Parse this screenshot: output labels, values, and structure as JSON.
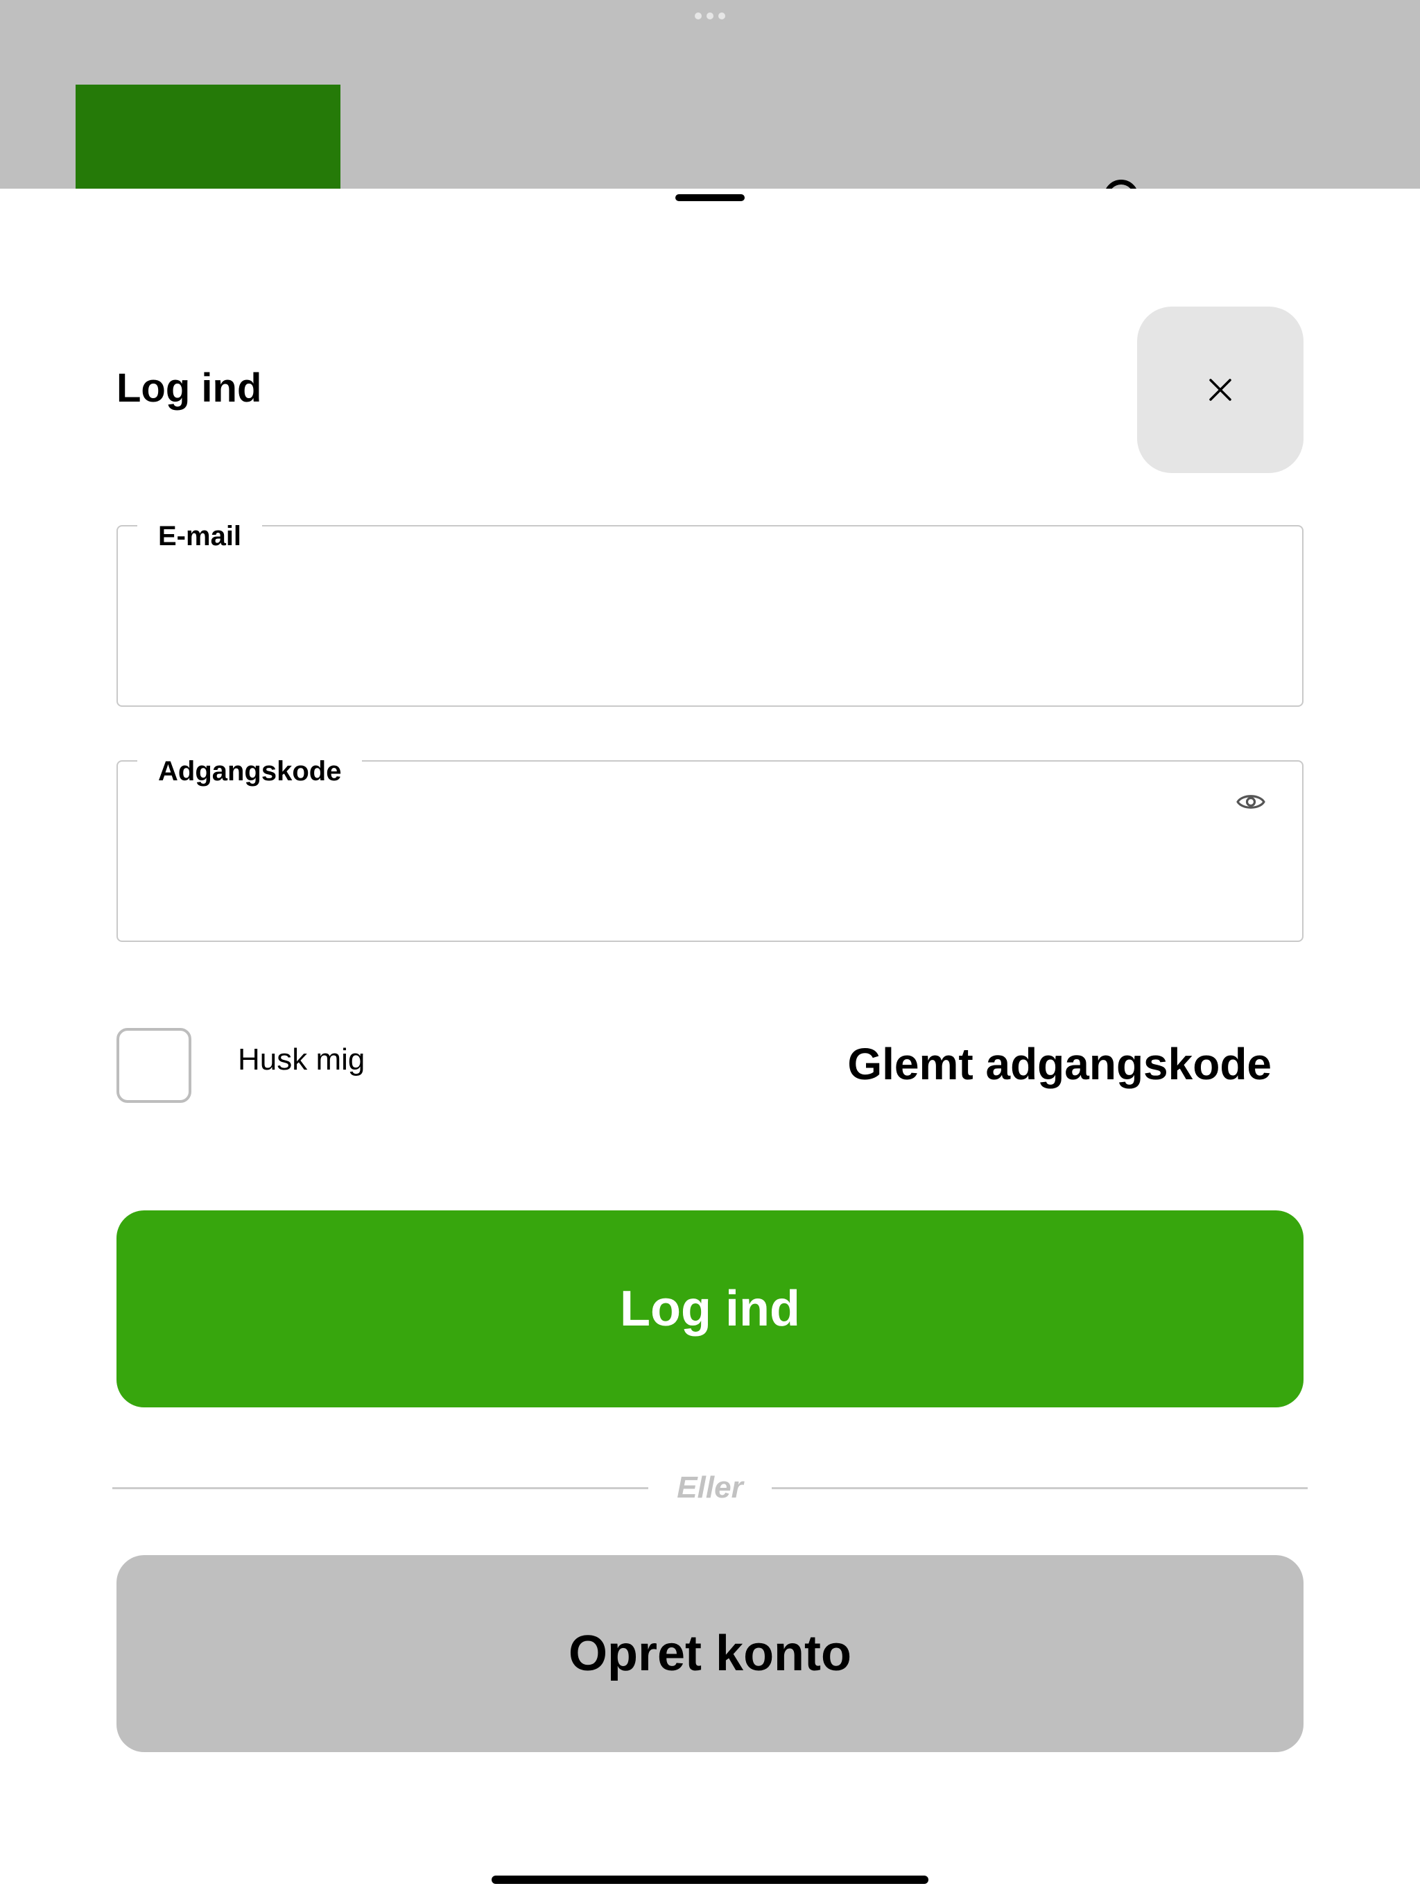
{
  "background_app": {
    "logo_color": "#257a08",
    "icons": [
      "more-dots-icon",
      "user-icon"
    ]
  },
  "sheet": {
    "title": "Log ind",
    "close_icon": "close-icon",
    "email": {
      "label": "E-mail",
      "value": "",
      "placeholder": ""
    },
    "password": {
      "label": "Adgangskode",
      "value": "",
      "placeholder": "",
      "toggle_icon": "eye-icon"
    },
    "remember_me": {
      "label": "Husk mig",
      "checked": false
    },
    "forgot_password": "Glemt adgangskode",
    "login_button": "Log ind",
    "divider_text": "Eller",
    "create_account_button": "Opret konto"
  },
  "colors": {
    "primary": "#37a60d",
    "secondary": "#bfbfbf",
    "close_button_bg": "#e5e5e5"
  }
}
